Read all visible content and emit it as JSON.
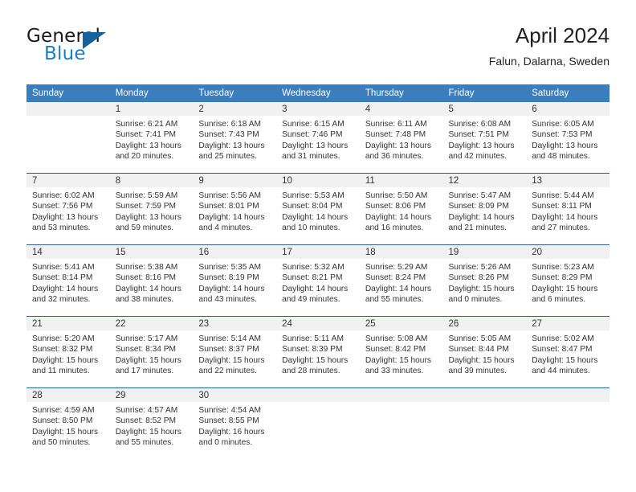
{
  "brand": {
    "name_top": "General",
    "name_bottom": "Blue",
    "accent_color": "#1f7bc1",
    "triangle_color": "#15619e"
  },
  "header": {
    "title": "April 2024",
    "subtitle": "Falun, Dalarna, Sweden"
  },
  "theme": {
    "header_bg": "#3a7ebf",
    "row_divider": "#2a6099",
    "daynum_band": "#f1f1f1",
    "text": "#333333"
  },
  "weekday_headers": [
    "Sunday",
    "Monday",
    "Tuesday",
    "Wednesday",
    "Thursday",
    "Friday",
    "Saturday"
  ],
  "weeks": [
    [
      {
        "day": "",
        "lines": []
      },
      {
        "day": "1",
        "lines": [
          "Sunrise: 6:21 AM",
          "Sunset: 7:41 PM",
          "Daylight: 13 hours",
          "and 20 minutes."
        ]
      },
      {
        "day": "2",
        "lines": [
          "Sunrise: 6:18 AM",
          "Sunset: 7:43 PM",
          "Daylight: 13 hours",
          "and 25 minutes."
        ]
      },
      {
        "day": "3",
        "lines": [
          "Sunrise: 6:15 AM",
          "Sunset: 7:46 PM",
          "Daylight: 13 hours",
          "and 31 minutes."
        ]
      },
      {
        "day": "4",
        "lines": [
          "Sunrise: 6:11 AM",
          "Sunset: 7:48 PM",
          "Daylight: 13 hours",
          "and 36 minutes."
        ]
      },
      {
        "day": "5",
        "lines": [
          "Sunrise: 6:08 AM",
          "Sunset: 7:51 PM",
          "Daylight: 13 hours",
          "and 42 minutes."
        ]
      },
      {
        "day": "6",
        "lines": [
          "Sunrise: 6:05 AM",
          "Sunset: 7:53 PM",
          "Daylight: 13 hours",
          "and 48 minutes."
        ]
      }
    ],
    [
      {
        "day": "7",
        "lines": [
          "Sunrise: 6:02 AM",
          "Sunset: 7:56 PM",
          "Daylight: 13 hours",
          "and 53 minutes."
        ]
      },
      {
        "day": "8",
        "lines": [
          "Sunrise: 5:59 AM",
          "Sunset: 7:59 PM",
          "Daylight: 13 hours",
          "and 59 minutes."
        ]
      },
      {
        "day": "9",
        "lines": [
          "Sunrise: 5:56 AM",
          "Sunset: 8:01 PM",
          "Daylight: 14 hours",
          "and 4 minutes."
        ]
      },
      {
        "day": "10",
        "lines": [
          "Sunrise: 5:53 AM",
          "Sunset: 8:04 PM",
          "Daylight: 14 hours",
          "and 10 minutes."
        ]
      },
      {
        "day": "11",
        "lines": [
          "Sunrise: 5:50 AM",
          "Sunset: 8:06 PM",
          "Daylight: 14 hours",
          "and 16 minutes."
        ]
      },
      {
        "day": "12",
        "lines": [
          "Sunrise: 5:47 AM",
          "Sunset: 8:09 PM",
          "Daylight: 14 hours",
          "and 21 minutes."
        ]
      },
      {
        "day": "13",
        "lines": [
          "Sunrise: 5:44 AM",
          "Sunset: 8:11 PM",
          "Daylight: 14 hours",
          "and 27 minutes."
        ]
      }
    ],
    [
      {
        "day": "14",
        "lines": [
          "Sunrise: 5:41 AM",
          "Sunset: 8:14 PM",
          "Daylight: 14 hours",
          "and 32 minutes."
        ]
      },
      {
        "day": "15",
        "lines": [
          "Sunrise: 5:38 AM",
          "Sunset: 8:16 PM",
          "Daylight: 14 hours",
          "and 38 minutes."
        ]
      },
      {
        "day": "16",
        "lines": [
          "Sunrise: 5:35 AM",
          "Sunset: 8:19 PM",
          "Daylight: 14 hours",
          "and 43 minutes."
        ]
      },
      {
        "day": "17",
        "lines": [
          "Sunrise: 5:32 AM",
          "Sunset: 8:21 PM",
          "Daylight: 14 hours",
          "and 49 minutes."
        ]
      },
      {
        "day": "18",
        "lines": [
          "Sunrise: 5:29 AM",
          "Sunset: 8:24 PM",
          "Daylight: 14 hours",
          "and 55 minutes."
        ]
      },
      {
        "day": "19",
        "lines": [
          "Sunrise: 5:26 AM",
          "Sunset: 8:26 PM",
          "Daylight: 15 hours",
          "and 0 minutes."
        ]
      },
      {
        "day": "20",
        "lines": [
          "Sunrise: 5:23 AM",
          "Sunset: 8:29 PM",
          "Daylight: 15 hours",
          "and 6 minutes."
        ]
      }
    ],
    [
      {
        "day": "21",
        "lines": [
          "Sunrise: 5:20 AM",
          "Sunset: 8:32 PM",
          "Daylight: 15 hours",
          "and 11 minutes."
        ]
      },
      {
        "day": "22",
        "lines": [
          "Sunrise: 5:17 AM",
          "Sunset: 8:34 PM",
          "Daylight: 15 hours",
          "and 17 minutes."
        ]
      },
      {
        "day": "23",
        "lines": [
          "Sunrise: 5:14 AM",
          "Sunset: 8:37 PM",
          "Daylight: 15 hours",
          "and 22 minutes."
        ]
      },
      {
        "day": "24",
        "lines": [
          "Sunrise: 5:11 AM",
          "Sunset: 8:39 PM",
          "Daylight: 15 hours",
          "and 28 minutes."
        ]
      },
      {
        "day": "25",
        "lines": [
          "Sunrise: 5:08 AM",
          "Sunset: 8:42 PM",
          "Daylight: 15 hours",
          "and 33 minutes."
        ]
      },
      {
        "day": "26",
        "lines": [
          "Sunrise: 5:05 AM",
          "Sunset: 8:44 PM",
          "Daylight: 15 hours",
          "and 39 minutes."
        ]
      },
      {
        "day": "27",
        "lines": [
          "Sunrise: 5:02 AM",
          "Sunset: 8:47 PM",
          "Daylight: 15 hours",
          "and 44 minutes."
        ]
      }
    ],
    [
      {
        "day": "28",
        "lines": [
          "Sunrise: 4:59 AM",
          "Sunset: 8:50 PM",
          "Daylight: 15 hours",
          "and 50 minutes."
        ]
      },
      {
        "day": "29",
        "lines": [
          "Sunrise: 4:57 AM",
          "Sunset: 8:52 PM",
          "Daylight: 15 hours",
          "and 55 minutes."
        ]
      },
      {
        "day": "30",
        "lines": [
          "Sunrise: 4:54 AM",
          "Sunset: 8:55 PM",
          "Daylight: 16 hours",
          "and 0 minutes."
        ]
      },
      {
        "day": "",
        "lines": []
      },
      {
        "day": "",
        "lines": []
      },
      {
        "day": "",
        "lines": []
      },
      {
        "day": "",
        "lines": []
      }
    ]
  ]
}
